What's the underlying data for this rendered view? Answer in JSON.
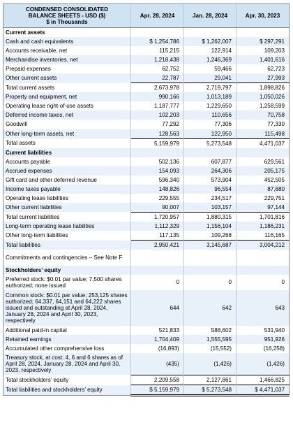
{
  "header": {
    "title_line1": "CONDENSED CONSOLIDATED",
    "title_line2": "BALANCE SHEETS - USD ($)",
    "title_line3": "$ in Thousands",
    "col1": "Apr. 28, 2024",
    "col2": "Jan. 28, 2024",
    "col3": "Apr. 30, 2023"
  },
  "rows": [
    {
      "label": "Current assets",
      "c1": "",
      "c2": "",
      "c3": "",
      "kind": "section"
    },
    {
      "label": "Cash and cash equivalents",
      "c1": "$ 1,254,786",
      "c2": "$ 1,262,007",
      "c3": "$ 297,291"
    },
    {
      "label": "Accounts receivable, net",
      "c1": "115,215",
      "c2": "122,914",
      "c3": "109,203"
    },
    {
      "label": "Merchandise inventories, net",
      "c1": "1,218,438",
      "c2": "1,246,369",
      "c3": "1,401,616"
    },
    {
      "label": "Prepaid expenses",
      "c1": "62,752",
      "c2": "59,466",
      "c3": "62,723"
    },
    {
      "label": "Other current assets",
      "c1": "22,787",
      "c2": "29,041",
      "c3": "27,993"
    },
    {
      "label": "Total current assets",
      "c1": "2,673,978",
      "c2": "2,719,797",
      "c3": "1,898,826",
      "rule": true
    },
    {
      "label": "Property and equipment, net",
      "c1": "990,166",
      "c2": "1,013,189",
      "c3": "1,050,026"
    },
    {
      "label": "Operating lease right-of-use assets",
      "c1": "1,187,777",
      "c2": "1,229,650",
      "c3": "1,258,599"
    },
    {
      "label": "Deferred income taxes, net",
      "c1": "102,203",
      "c2": "110,656",
      "c3": "70,758"
    },
    {
      "label": "Goodwill",
      "c1": "77,292",
      "c2": "77,306",
      "c3": "77,330"
    },
    {
      "label": "Other long-term assets, net",
      "c1": "128,563",
      "c2": "122,950",
      "c3": "115,498"
    },
    {
      "label": "Total assets",
      "c1": "5,159,979",
      "c2": "5,273,548",
      "c3": "4,471,037",
      "rule": true
    },
    {
      "label": "Current liabilities",
      "c1": "",
      "c2": "",
      "c3": "",
      "kind": "section"
    },
    {
      "label": "Accounts payable",
      "c1": "502,136",
      "c2": "607,877",
      "c3": "629,561"
    },
    {
      "label": "Accrued expenses",
      "c1": "154,093",
      "c2": "264,306",
      "c3": "205,175"
    },
    {
      "label": "Gift card and other deferred revenue",
      "c1": "596,340",
      "c2": "573,904",
      "c3": "452,505"
    },
    {
      "label": "Income taxes payable",
      "c1": "148,826",
      "c2": "96,554",
      "c3": "87,680"
    },
    {
      "label": "Operating lease liabilities",
      "c1": "229,555",
      "c2": "234,517",
      "c3": "229,751"
    },
    {
      "label": "Other current liabilities",
      "c1": "90,007",
      "c2": "103,157",
      "c3": "97,144"
    },
    {
      "label": "Total current liabilities",
      "c1": "1,720,957",
      "c2": "1,880,315",
      "c3": "1,701,816",
      "rule": true
    },
    {
      "label": "Long-term operating lease liabilities",
      "c1": "1,112,329",
      "c2": "1,156,104",
      "c3": "1,186,231"
    },
    {
      "label": "Other long-term liabilities",
      "c1": "117,135",
      "c2": "109,268",
      "c3": "116,165"
    },
    {
      "label": "Total liabilities",
      "c1": "2,950,421",
      "c2": "3,145,687",
      "c3": "3,004,212",
      "rule": true
    },
    {
      "label": "Commitments and contingencies – See Note F",
      "c1": "",
      "c2": "",
      "c3": "",
      "lines": 2
    },
    {
      "label": "Stockholders’ equity",
      "c1": "",
      "c2": "",
      "c3": "",
      "kind": "section"
    },
    {
      "label": "Preferred stock: $0.01 par value; 7,500 shares authorized; none issued",
      "c1": "0",
      "c2": "0",
      "c3": "0",
      "lines": 2
    },
    {
      "label": "Common stock: $0.01 par value; 253,125 shares authorized; 64,337, 64,151 and 64,222 shares issued and outstanding at April 28, 2024, January 28, 2024 and April 30, 2023, respectively",
      "c1": "644",
      "c2": "642",
      "c3": "643",
      "lines": 5
    },
    {
      "label": "Additional paid-in capital",
      "c1": "521,833",
      "c2": "588,602",
      "c3": "531,940"
    },
    {
      "label": "Retained earnings",
      "c1": "1,704,409",
      "c2": "1,555,595",
      "c3": "951,926"
    },
    {
      "label": "Accumulated other comprehensive loss",
      "c1": "(16,893)",
      "c2": "(15,552)",
      "c3": "(16,258)"
    },
    {
      "label": "Treasury stock, at cost: 4, 6 and 6 shares as of April 28, 2024, January 28, 2024 and April 30, 2023, respectively",
      "c1": "(435)",
      "c2": "(1,426)",
      "c3": "(1,426)",
      "lines": 3
    },
    {
      "label": "Total stockholders’ equity",
      "c1": "2,209,558",
      "c2": "2,127,861",
      "c3": "1,466,825",
      "rule": true
    },
    {
      "label": "Total liabilities and stockholders’ equity",
      "c1": "$ 5,159,979",
      "c2": "$ 5,273,548",
      "c3": "$ 4,471,037",
      "dbl": true
    }
  ]
}
